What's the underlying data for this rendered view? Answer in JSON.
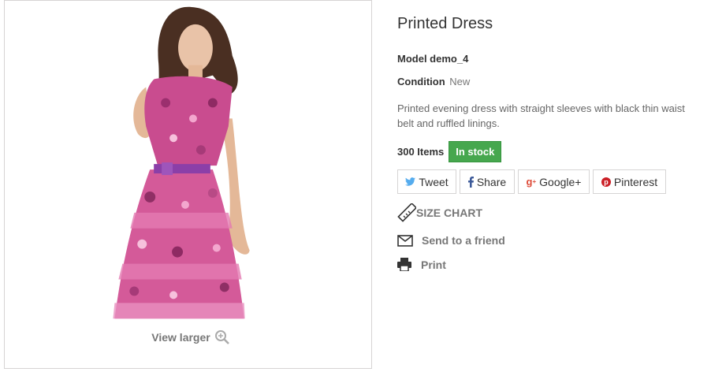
{
  "product": {
    "title": "Printed Dress",
    "model": "Model demo_4",
    "condition_label": "Condition",
    "condition_value": "New",
    "description": "Printed evening dress with straight sleeves with black thin waist belt and ruffled linings.",
    "quantity": "300 Items",
    "availability": "In stock"
  },
  "image": {
    "view_larger_label": "View larger"
  },
  "social": {
    "tweet": "Tweet",
    "share": "Share",
    "google": "Google+",
    "pinterest": "Pinterest"
  },
  "links": {
    "size_chart": "SIZE CHART",
    "send_friend": "Send to a friend",
    "print": "Print"
  },
  "colors": {
    "in_stock": "#46a74e",
    "twitter": "#55acee",
    "facebook": "#3b5998",
    "google": "#dd4b39",
    "pinterest": "#cb2027"
  }
}
